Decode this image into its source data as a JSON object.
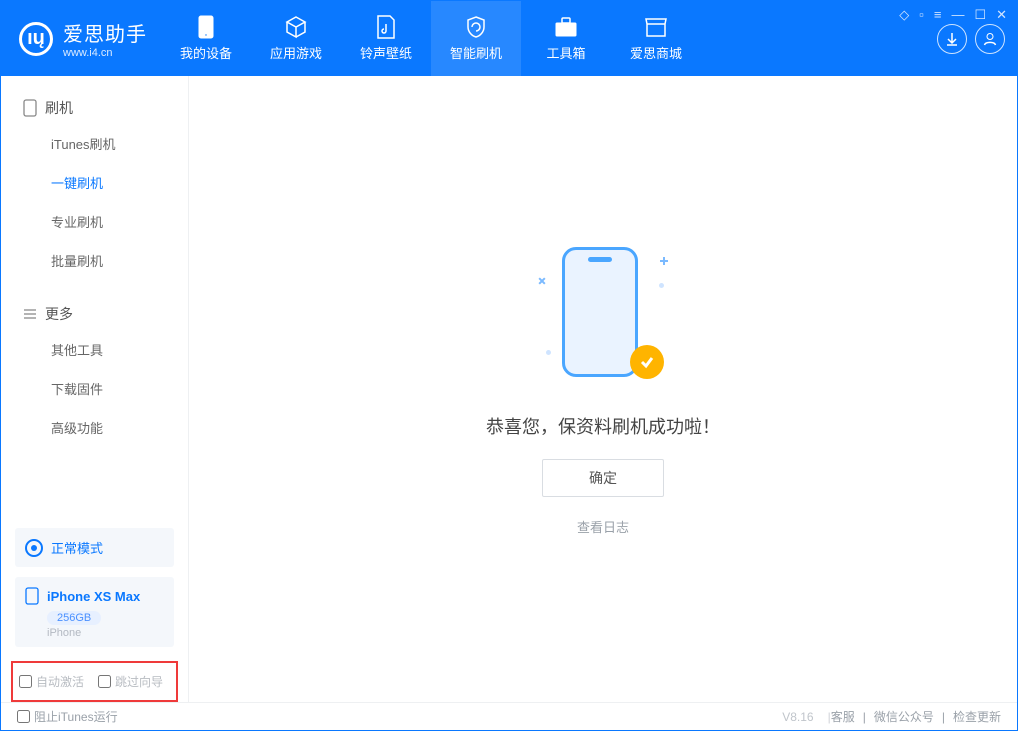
{
  "brand": {
    "name": "爱思助手",
    "url": "www.i4.cn"
  },
  "nav": {
    "items": [
      {
        "label": "我的设备"
      },
      {
        "label": "应用游戏"
      },
      {
        "label": "铃声壁纸"
      },
      {
        "label": "智能刷机"
      },
      {
        "label": "工具箱"
      },
      {
        "label": "爱思商城"
      }
    ]
  },
  "sidebar": {
    "section1": {
      "title": "刷机",
      "items": [
        "iTunes刷机",
        "一键刷机",
        "专业刷机",
        "批量刷机"
      ]
    },
    "section2": {
      "title": "更多",
      "items": [
        "其他工具",
        "下载固件",
        "高级功能"
      ]
    },
    "status": "正常模式",
    "device": {
      "name": "iPhone XS Max",
      "capacity": "256GB",
      "type": "iPhone"
    },
    "opts": {
      "auto_activate": "自动激活",
      "skip_guide": "跳过向导"
    }
  },
  "main": {
    "success": "恭喜您，保资料刷机成功啦！",
    "ok": "确定",
    "view_log": "查看日志"
  },
  "footer": {
    "block_itunes": "阻止iTunes运行",
    "version": "V8.16",
    "links": [
      "客服",
      "微信公众号",
      "检查更新"
    ]
  }
}
